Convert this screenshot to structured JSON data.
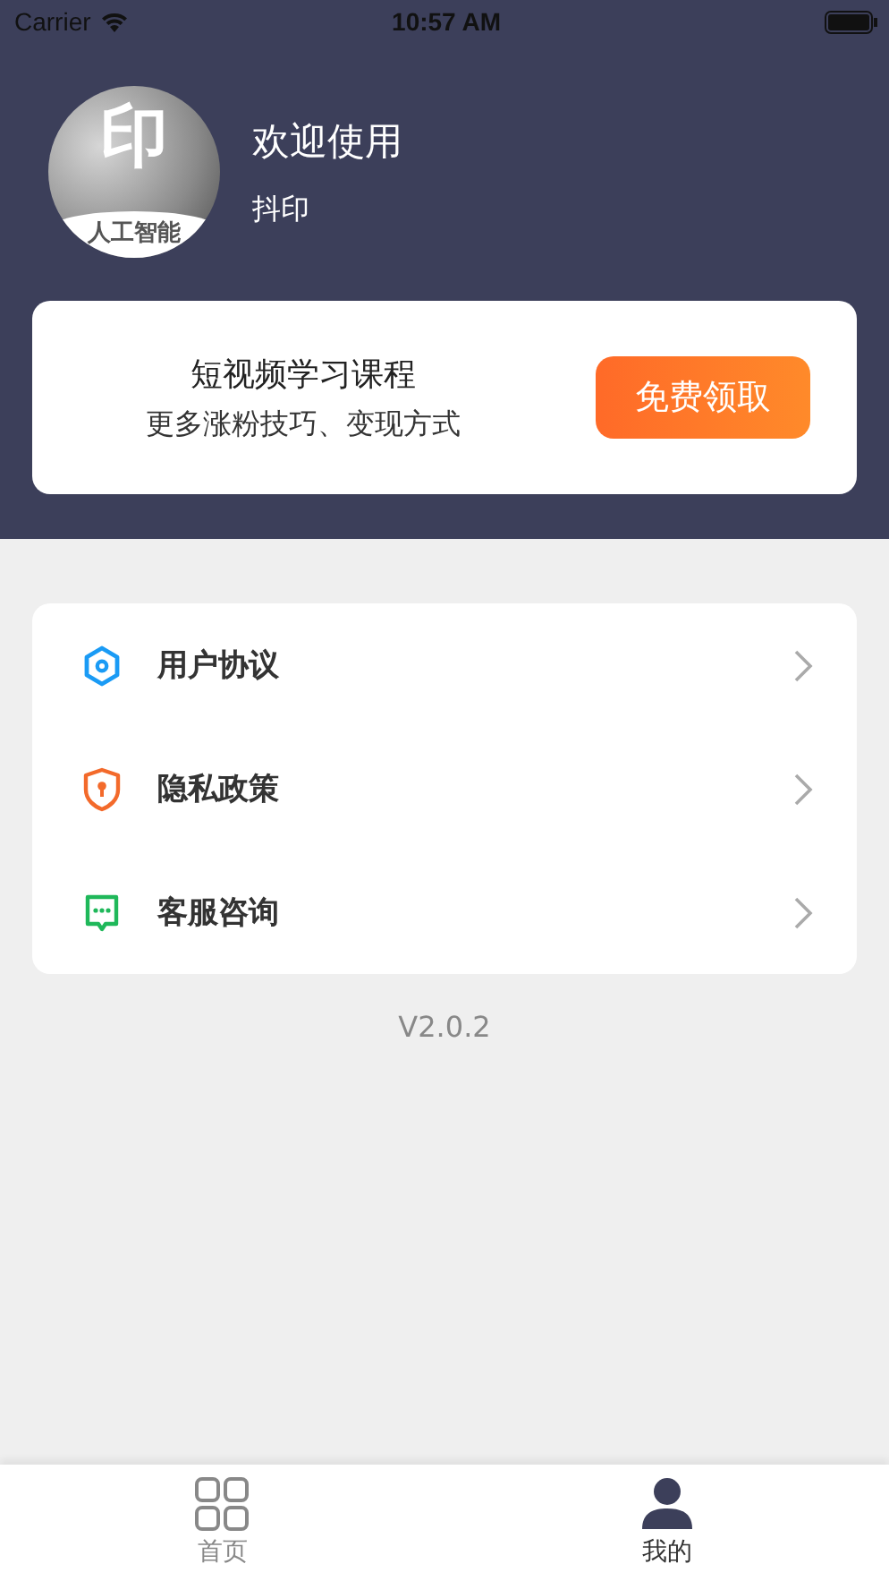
{
  "status_bar": {
    "carrier": "Carrier",
    "time": "10:57 AM"
  },
  "profile": {
    "avatar": {
      "mark": "印",
      "caption": "人工智能"
    },
    "greeting": "欢迎使用",
    "name": "抖印"
  },
  "promo": {
    "title": "短视频学习课程",
    "subtitle": "更多涨粉技巧、变现方式",
    "button": "免费领取"
  },
  "menu": [
    {
      "kind": "agreement",
      "label": "用户协议"
    },
    {
      "kind": "privacy",
      "label": "隐私政策"
    },
    {
      "kind": "support",
      "label": "客服咨询"
    }
  ],
  "version": "V2.0.2",
  "tab_bar": [
    {
      "kind": "home",
      "label": "首页",
      "selected": false
    },
    {
      "kind": "profile",
      "label": "我的",
      "selected": true
    }
  ]
}
